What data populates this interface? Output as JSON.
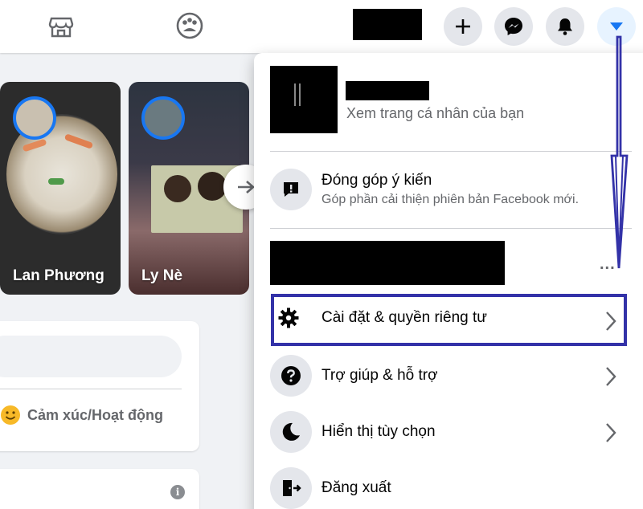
{
  "menu": {
    "profile_sub": "Xem trang cá nhân của bạn",
    "feedback_title": "Đóng góp ý kiến",
    "feedback_sub": "Góp phần cải thiện phiên bản Facebook mới.",
    "more": "...",
    "items": [
      {
        "label": "Cài đặt & quyền riêng tư"
      },
      {
        "label": "Trợ giúp & hỗ trợ"
      },
      {
        "label": "Hiển thị tùy chọn"
      },
      {
        "label": "Đăng xuất"
      }
    ]
  },
  "stories": [
    {
      "name": "Lan Phương"
    },
    {
      "name": "Ly Nè"
    }
  ],
  "composer": {
    "feeling_label": "Cảm xúc/Hoạt động"
  },
  "colors": {
    "brand": "#1877f2",
    "annotation": "#3332a8"
  }
}
